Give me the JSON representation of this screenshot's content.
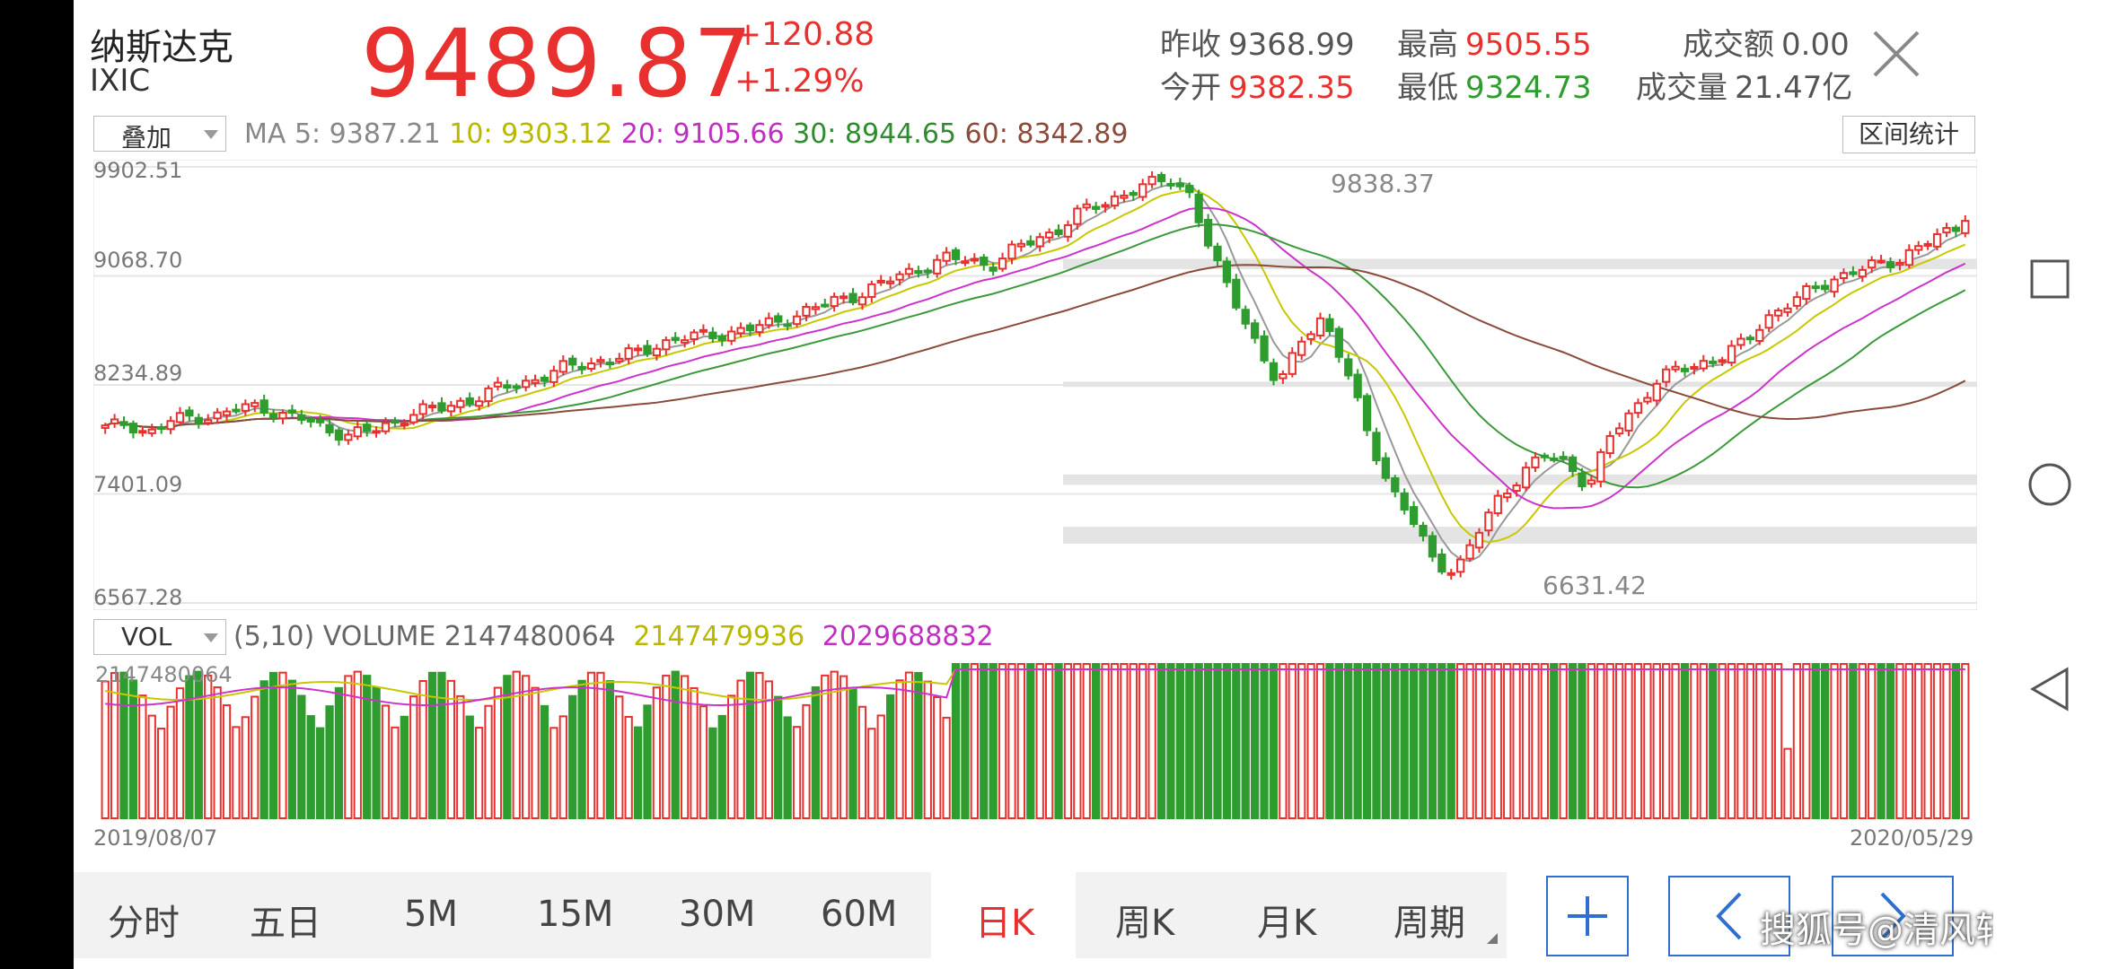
{
  "header": {
    "name": "纳斯达克",
    "code": "IXIC",
    "price": "9489.87",
    "change": "+120.88",
    "change_pct": "+1.29%",
    "prev_close_label": "昨收",
    "prev_close": "9368.99",
    "open_label": "今开",
    "open": "9382.35",
    "high_label": "最高",
    "high": "9505.55",
    "low_label": "最低",
    "low": "9324.73",
    "amount_label": "成交额",
    "amount": "0.00",
    "volume_label": "成交量",
    "volume": "21.47亿"
  },
  "controls": {
    "overlay_select": "叠加",
    "interval_stats": "区间统计",
    "vol_select": "VOL"
  },
  "ma": {
    "ma5": "MA 5: 9387.21",
    "ma10": "10: 9303.12",
    "ma20": "20: 9105.66",
    "ma30": "30: 8944.65",
    "ma60": "60: 8342.89"
  },
  "price_axis": {
    "ticks": [
      "9902.51",
      "9068.70",
      "8234.89",
      "7401.09",
      "6567.28"
    ],
    "peak_label": "9838.37",
    "trough_label": "6631.42"
  },
  "volume": {
    "title": "(5,10) VOLUME 2147480064",
    "ma5": "2147479936",
    "ma10": "2029688832",
    "axis_max": "2147480064"
  },
  "dates": {
    "start": "2019/08/07",
    "end": "2020/05/29"
  },
  "tabs": [
    "分时",
    "五日",
    "5M",
    "15M",
    "30M",
    "60M",
    "日K",
    "周K",
    "月K",
    "周期"
  ],
  "active_tab": "日K",
  "watermark": "搜狐号@清风轩",
  "colors": {
    "up": "#e8312f",
    "down": "#2e9c2e",
    "ma5": "#999999",
    "ma10": "#c8c800",
    "ma20": "#cc33cc",
    "ma30": "#3a9a3a",
    "ma60": "#8b4a3a"
  },
  "chart_data": {
    "type": "candlestick",
    "x_range": [
      "2019/08/07",
      "2020/05/29"
    ],
    "ylim": [
      6567.28,
      9902.51
    ],
    "y_ticks": [
      9902.51,
      9068.7,
      8234.89,
      7401.09,
      6567.28
    ],
    "peak": 9838.37,
    "trough": 6631.42,
    "close_path": [
      7900,
      7950,
      7860,
      7960,
      8000,
      7990,
      8050,
      8080,
      8000,
      7970,
      7900,
      7850,
      7880,
      7950,
      8030,
      8050,
      8100,
      8150,
      8220,
      8260,
      8310,
      8380,
      8410,
      8430,
      8480,
      8550,
      8590,
      8610,
      8630,
      8660,
      8700,
      8760,
      8820,
      8880,
      8930,
      9000,
      9080,
      9140,
      9200,
      9190,
      9150,
      9260,
      9350,
      9420,
      9550,
      9620,
      9700,
      9750,
      9820,
      9700,
      9200,
      8900,
      8550,
      8200,
      8600,
      8750,
      8350,
      7900,
      7450,
      7200,
      6900,
      6800,
      7100,
      7400,
      7550,
      7700,
      7650,
      7450,
      7850,
      8050,
      8250,
      8350,
      8400,
      8450,
      8550,
      8750,
      8850,
      8950,
      9050,
      9100,
      9150,
      9200,
      9300,
      9380,
      9489.87
    ],
    "volume_ma5": 2147479936,
    "volume_ma10": 2029688832
  }
}
